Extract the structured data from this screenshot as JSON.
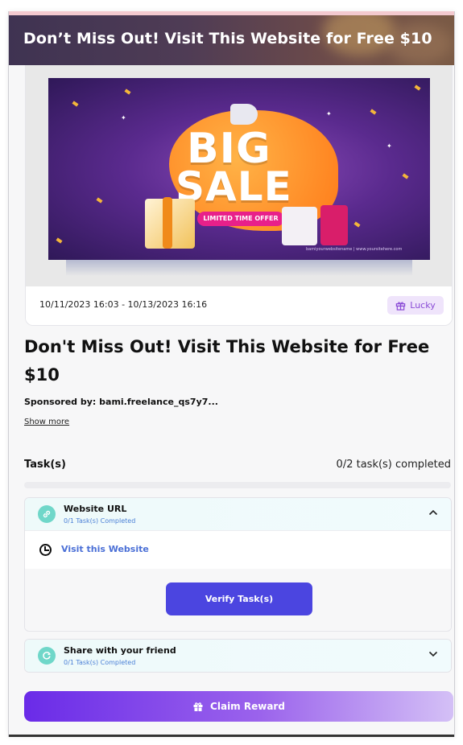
{
  "header": {
    "title": "Don’t Miss Out! Visit This Website for Free $10"
  },
  "banner": {
    "big": "BIG",
    "sale": "SALE",
    "offer": "LIMITED TIME OFFER",
    "fine_print": "bamiyourwebsitename  |  www.yoursitehere.com"
  },
  "card": {
    "date_range": "10/11/2023 16:03 - 10/13/2023 16:16",
    "badge": "Lucky"
  },
  "campaign": {
    "title": "Don't Miss Out! Visit This Website for Free $10",
    "sponsor": "Sponsored by: bami.freelance_qs7y7...",
    "show_more": "Show more"
  },
  "tasks": {
    "label": "Task(s)",
    "count": "0/2 task(s) completed",
    "progress": 0,
    "items": [
      {
        "title": "Website URL",
        "sub": "0/1 Task(s) Completed",
        "link": "Visit this Website",
        "button": "Verify Task(s)",
        "expanded": true
      },
      {
        "title": "Share with your friend",
        "sub": "0/1 Task(s) Completed",
        "expanded": false
      }
    ]
  },
  "claim": {
    "label": "Claim Reward"
  },
  "colors": {
    "accent": "#4b45e0",
    "claim_start": "#6a2be8",
    "claim_end": "#d4c0f6",
    "link": "#4a6fd6",
    "badge_bg": "#efe4fb"
  }
}
